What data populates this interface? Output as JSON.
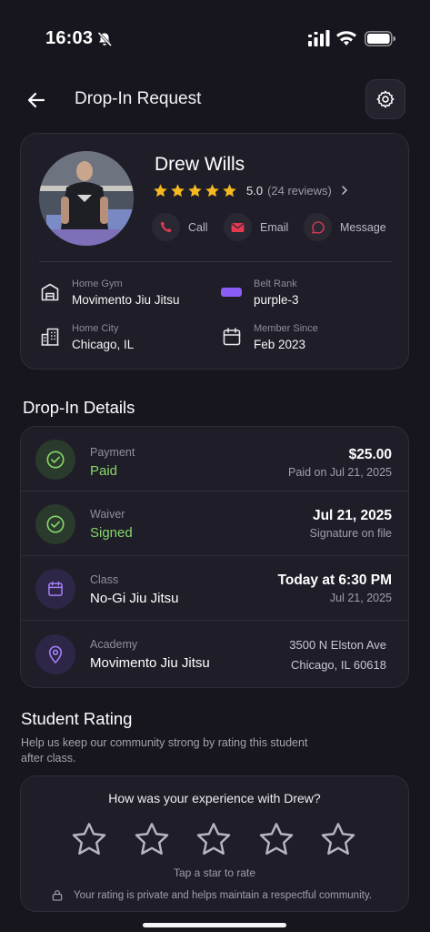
{
  "status_bar": {
    "time": "16:03"
  },
  "header": {
    "title": "Drop-In Request"
  },
  "profile": {
    "name": "Drew Wills",
    "rating": "5.0",
    "reviews": "(24 reviews)",
    "stars": 5,
    "actions": {
      "call": "Call",
      "email": "Email",
      "message": "Message"
    },
    "home_gym_label": "Home Gym",
    "home_gym": "Movimento Jiu Jitsu",
    "belt_label": "Belt Rank",
    "belt": "purple-3",
    "city_label": "Home City",
    "city": "Chicago, IL",
    "since_label": "Member Since",
    "since": "Feb 2023"
  },
  "details": {
    "title": "Drop-In Details",
    "payment": {
      "label": "Payment",
      "status": "Paid",
      "amount": "$25.00",
      "sub": "Paid on Jul 21, 2025"
    },
    "waiver": {
      "label": "Waiver",
      "status": "Signed",
      "date": "Jul 21, 2025",
      "sub": "Signature on file"
    },
    "class": {
      "label": "Class",
      "name": "No-Gi Jiu Jitsu",
      "time": "Today at 6:30 PM",
      "date": "Jul 21, 2025"
    },
    "academy": {
      "label": "Academy",
      "name": "Movimento Jiu Jitsu",
      "addr1": "3500 N Elston Ave",
      "addr2": "Chicago, IL 60618"
    }
  },
  "student_rating": {
    "title": "Student Rating",
    "desc": "Help us keep our community strong by rating this student after class.",
    "question": "How was your experience with Drew?",
    "hint": "Tap a star to rate",
    "privacy": "Your rating is private and helps maintain a respectful community.",
    "selected_stars": 0
  },
  "colors": {
    "background": "#17161f",
    "card": "#1f1e28",
    "star_gold": "#f5b820",
    "accent_red": "#e53950",
    "accent_green": "#86d66a",
    "accent_purple": "#8b5cf6"
  }
}
